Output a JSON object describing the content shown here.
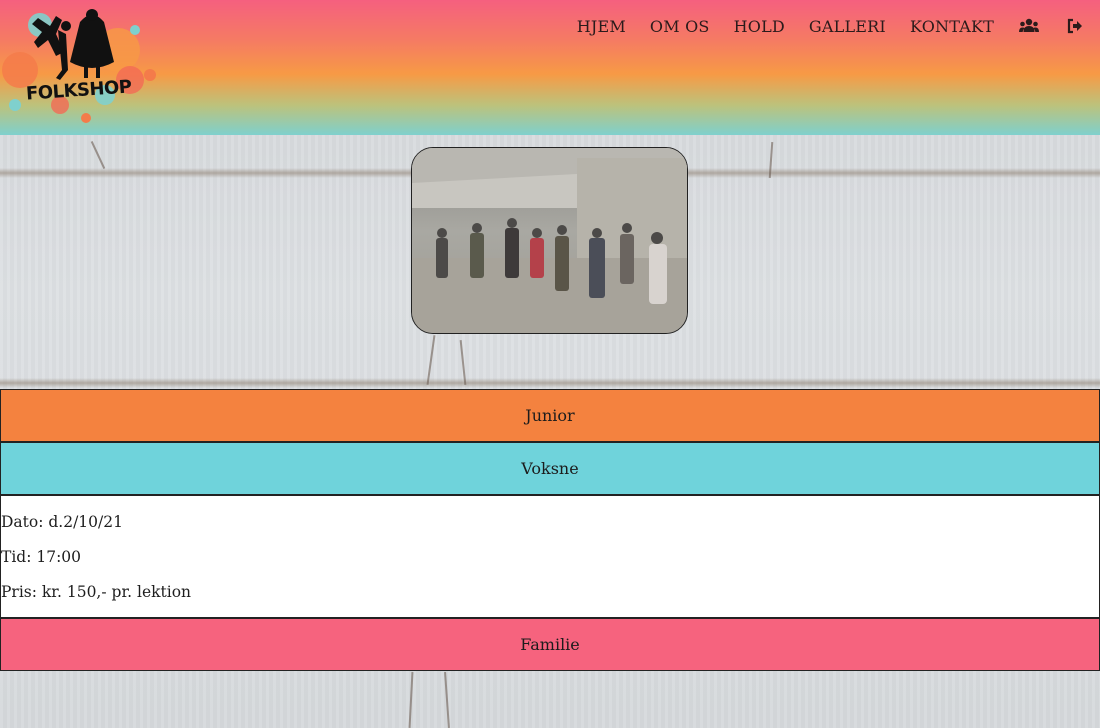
{
  "header": {
    "logo_text": "FOLKSHOP",
    "nav": [
      {
        "label": "HJEM"
      },
      {
        "label": "OM OS"
      },
      {
        "label": "HOLD"
      },
      {
        "label": "GALLERI"
      },
      {
        "label": "KONTAKT"
      }
    ],
    "icons": [
      "users-icon",
      "sign-out-icon"
    ]
  },
  "hero": {
    "image": "dance-hall-photo"
  },
  "sections": [
    {
      "title": "Junior",
      "color": "#f4823f"
    },
    {
      "title": "Voksne",
      "color": "#6fd3db",
      "details": {
        "date": "Dato: d.2/10/21",
        "time": "Tid: 17:00",
        "price": "Pris: kr. 150,- pr. lektion"
      }
    },
    {
      "title": "Familie",
      "color": "#f6637e"
    }
  ]
}
